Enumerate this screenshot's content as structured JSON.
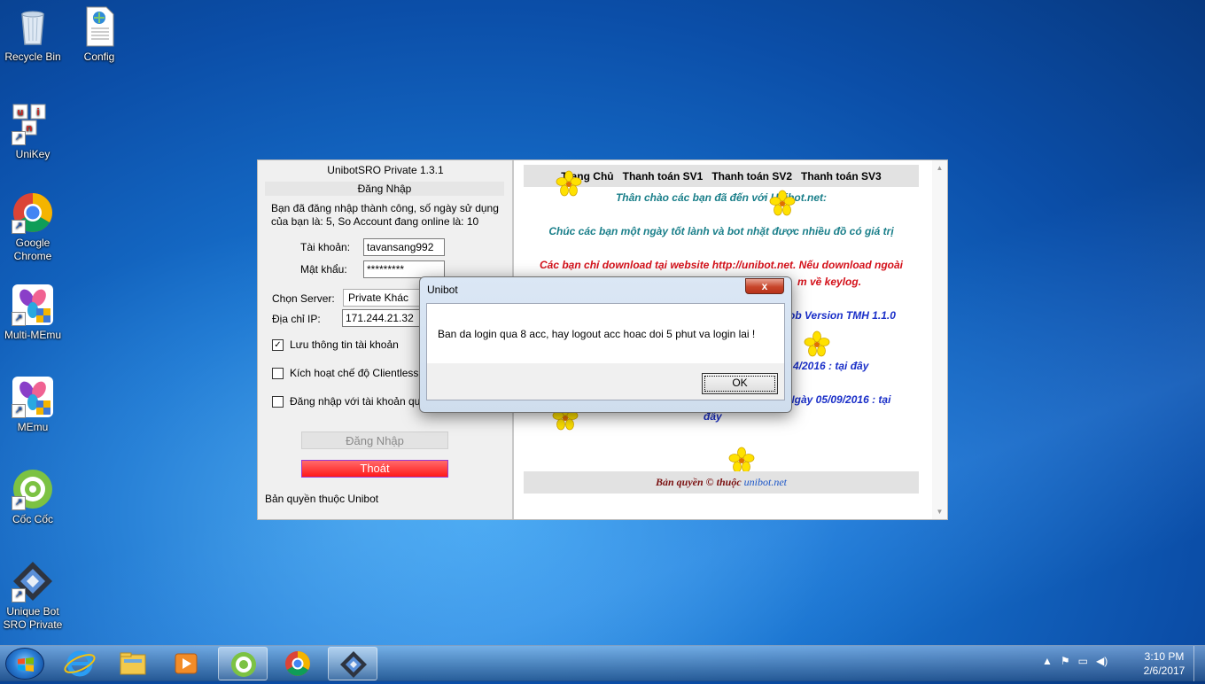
{
  "desktop": {
    "icons": [
      {
        "label": "Recycle Bin"
      },
      {
        "label": "Config"
      },
      {
        "label": "UniKey"
      },
      {
        "label": "Google Chrome"
      },
      {
        "label": "Multi-MEmu"
      },
      {
        "label": "MEmu"
      },
      {
        "label": "Cốc Cốc"
      },
      {
        "label": "Unique Bot SRO Private"
      }
    ]
  },
  "app": {
    "title": "UnibotSRO Private 1.3.1",
    "section_header": "Đăng Nhập",
    "status_text": "Bạn đã đăng nhập thành công, số ngày sử dụng của bạn là: 5, So Account đang online là: 10",
    "account_label": "Tài khoản:",
    "account_value": "tavansang992",
    "password_label": "Mật khẩu:",
    "password_value": "*********",
    "server_label": "Chọn Server:",
    "server_value": "Private Khác",
    "ip_label": "Địa chỉ IP:",
    "ip_value": "171.244.21.32",
    "save_info_label": "Lưu thông tin tài khoản",
    "clientless_label": "Kích hoạt chế độ Clientless",
    "admin_login_label": "Đăng nhập với tài khoản qu",
    "login_button": "Đăng Nhập",
    "exit_button": "Thoát",
    "copyright": "Bản quyền thuộc Unibot"
  },
  "web": {
    "nav": [
      "Trang Chủ",
      "Thanh toán SV1",
      "Thanh toán SV2",
      "Thanh toán SV3"
    ],
    "welcome": "Thân chào các bạn đã đến với Unibot.net:",
    "wish": "Chúc các bạn một ngày tốt lành và bot nhặt được nhiều đồ có giá trị",
    "warning_1": "Các bạn chỉ download tại website http://unibot.net. Nếu download ngoài",
    "warning_2": "m về keylog.",
    "version_line": "ob Version TMH 1.1.0",
    "date_line_1": "4/2016 : tại đây",
    "date_line_2": "Ngày 05/09/2016 : tại",
    "date_line_2b": "đây",
    "footer_text": "Bản quyền © thuộc ",
    "footer_link": "unibot.net"
  },
  "dialog": {
    "title": "Unibot",
    "close": "x",
    "message": "Ban da login qua 8 acc, hay logout acc hoac doi 5 phut va login lai !",
    "ok_button": "OK"
  },
  "taskbar": {
    "time": "3:10 PM",
    "date": "2/6/2017"
  },
  "colors": {
    "exit_button": "#ff2a2a",
    "welcome_text": "#1a7f8a",
    "warning_text": "#d4111a",
    "link_text": "#1a2fc8"
  }
}
